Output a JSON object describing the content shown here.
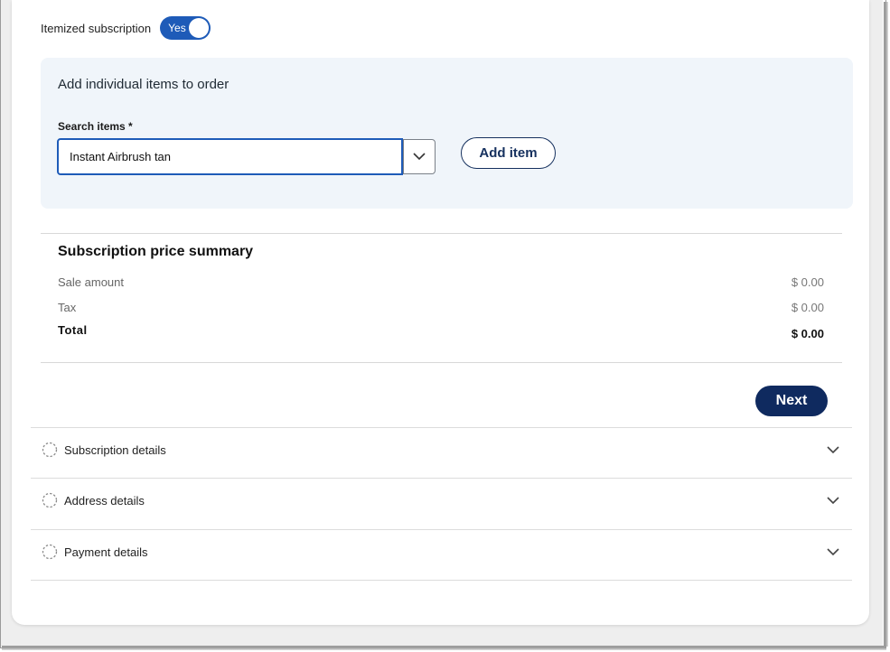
{
  "toggle": {
    "label": "Itemized subscription",
    "state_text": "Yes",
    "on": true,
    "color": "#1e5bb8"
  },
  "item_panel": {
    "title": "Add individual items to order",
    "search_label": "Search items *",
    "search_value": "Instant Airbrush tan",
    "dropdown_icon": "chevron-down-icon",
    "add_button": "Add item"
  },
  "summary": {
    "title": "Subscription price summary",
    "rows": [
      {
        "label": "Sale amount",
        "value": "$ 0.00"
      },
      {
        "label": "Tax",
        "value": "$ 0.00"
      }
    ],
    "total_label": "Total",
    "total_value": "$ 0.00"
  },
  "next_button": "Next",
  "sections": [
    {
      "label": "Subscription details",
      "icon": "dashed-circle-icon"
    },
    {
      "label": "Address details",
      "icon": "dashed-circle-icon"
    },
    {
      "label": "Payment details",
      "icon": "dashed-circle-icon"
    }
  ],
  "colors": {
    "accent": "#1e5bb8",
    "primary_dark": "#0f2a5f",
    "panel_bg": "#f0f5fa"
  }
}
